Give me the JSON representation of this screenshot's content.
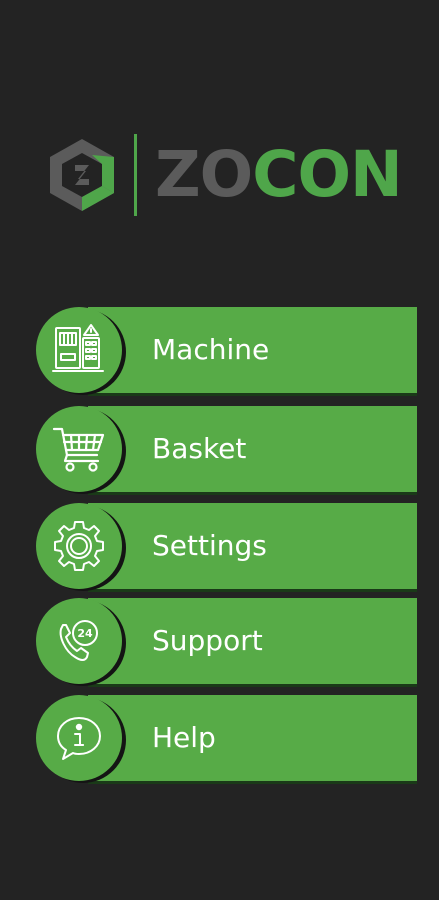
{
  "app": {
    "logo": {
      "text_part1": "ZO",
      "text_part2": "CON",
      "icon": "zocon-hexagon-logo-icon"
    }
  },
  "colors": {
    "background": "#232323",
    "accent": "#57ab47",
    "logo_gray": "#5b5b5b",
    "logo_green": "#4fa64a"
  },
  "menu": {
    "items": [
      {
        "label": "Machine",
        "icon": "vending-machine-icon"
      },
      {
        "label": "Basket",
        "icon": "shopping-cart-icon"
      },
      {
        "label": "Settings",
        "icon": "gear-icon"
      },
      {
        "label": "Support",
        "icon": "phone-24-icon"
      },
      {
        "label": "Help",
        "icon": "info-bubble-icon"
      }
    ]
  }
}
